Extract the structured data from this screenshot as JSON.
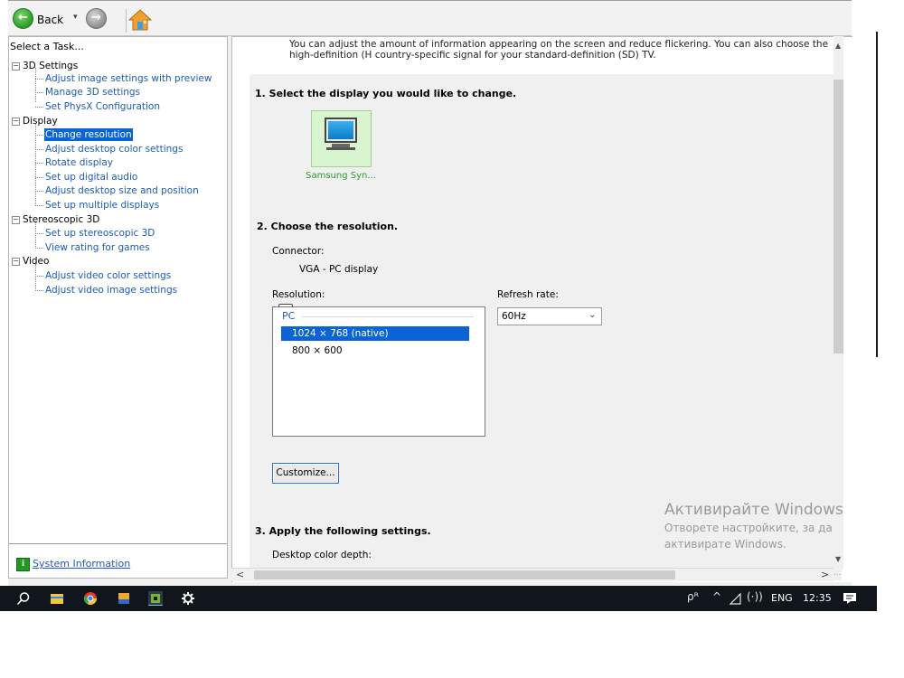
{
  "toolbar": {
    "back_label": "Back",
    "back_glyph": "←",
    "forward_glyph": "→",
    "dropdown_glyph": "▾"
  },
  "task_pane": {
    "title": "Select a Task...",
    "categories": [
      {
        "label": "3D Settings",
        "items": [
          "Adjust image settings with preview",
          "Manage 3D settings",
          "Set PhysX Configuration"
        ]
      },
      {
        "label": "Display",
        "items": [
          "Change resolution",
          "Adjust desktop color settings",
          "Rotate display",
          "Set up digital audio",
          "Adjust desktop size and position",
          "Set up multiple displays"
        ]
      },
      {
        "label": "Stereoscopic 3D",
        "items": [
          "Set up stereoscopic 3D",
          "View rating for games"
        ]
      },
      {
        "label": "Video",
        "items": [
          "Adjust video color settings",
          "Adjust video image settings"
        ]
      }
    ],
    "expander_glyph": "−",
    "selected_item": "Change resolution",
    "system_info_label": "System Information",
    "system_info_glyph": "i"
  },
  "content": {
    "intro": "You can adjust the amount of information appearing on the screen and reduce flickering. You can also choose the high-definition (H country-specific signal for your standard-definition (SD) TV.",
    "section1_title": "1. Select the display you would like to change.",
    "display_name": "Samsung Syn...",
    "section2_title": "2. Choose the resolution.",
    "connector_label": "Connector:",
    "connector_value": "VGA - PC display",
    "resolution_label": "Resolution:",
    "resolution_group": "PC",
    "resolutions": [
      "1024 × 768 (native)",
      "800 × 600"
    ],
    "refresh_label": "Refresh rate:",
    "refresh_value": "60Hz",
    "customize_label": "Customize...",
    "section3_title": "3. Apply the following settings.",
    "color_depth_label": "Desktop color depth:"
  },
  "watermark": {
    "title": "Активирайте Windows",
    "line1": "Отворете настройките, за да",
    "line2": "активирате Windows."
  },
  "scrollbars": {
    "up": "▲",
    "down": "▼",
    "left": "<",
    "right": ">"
  },
  "taskbar": {
    "language": "ENG",
    "time": "12:35",
    "tray_people": "ρᴿ",
    "tray_chevron": "^",
    "tray_volume": "(·))"
  },
  "colors": {
    "selection": "#0a64d6",
    "link": "#1d5cb5",
    "nvidia_green": "#2c9a2c",
    "taskbar": "#10161c"
  }
}
